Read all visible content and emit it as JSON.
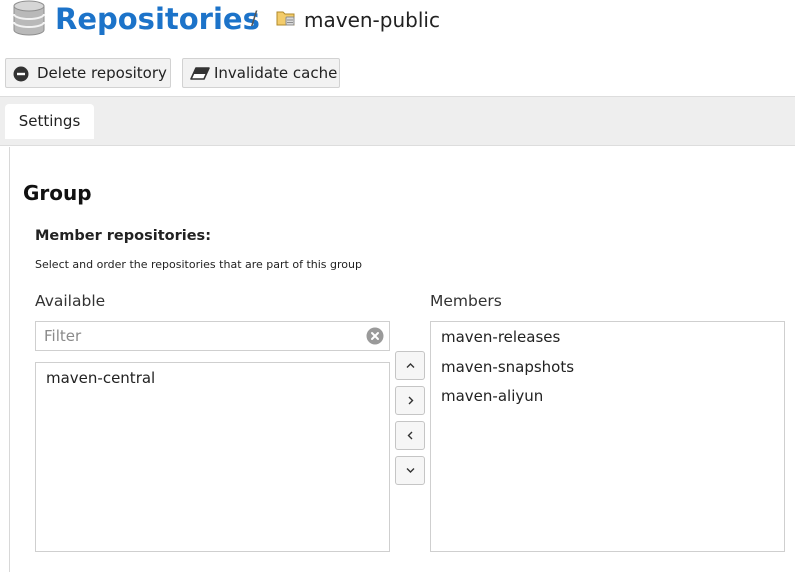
{
  "header": {
    "title": "Repositories",
    "separator": "/",
    "subtitle": "maven-public"
  },
  "toolbar": {
    "delete_label": "Delete repository",
    "invalidate_label": "Invalidate cache"
  },
  "tabs": [
    {
      "label": "Settings"
    }
  ],
  "group": {
    "heading": "Group",
    "member_label": "Member repositories:",
    "member_help": "Select and order the repositories that are part of this group",
    "available": {
      "label": "Available",
      "filter_placeholder": "Filter",
      "items": [
        "maven-central"
      ]
    },
    "members": {
      "label": "Members",
      "items": [
        "maven-releases",
        "maven-snapshots",
        "maven-aliyun"
      ]
    }
  },
  "colors": {
    "accent": "#1c73c9",
    "tab_bar": "#eeeeee"
  },
  "icons": {
    "header": "database-icon",
    "breadcrumb": "folder-repository-icon",
    "delete": "minus-circle-icon",
    "invalidate": "eraser-icon",
    "filter_clear": "clear-circle-icon",
    "move_up": "chevron-up-icon",
    "move_right": "chevron-right-icon",
    "move_left": "chevron-left-icon",
    "move_down": "chevron-down-icon"
  }
}
